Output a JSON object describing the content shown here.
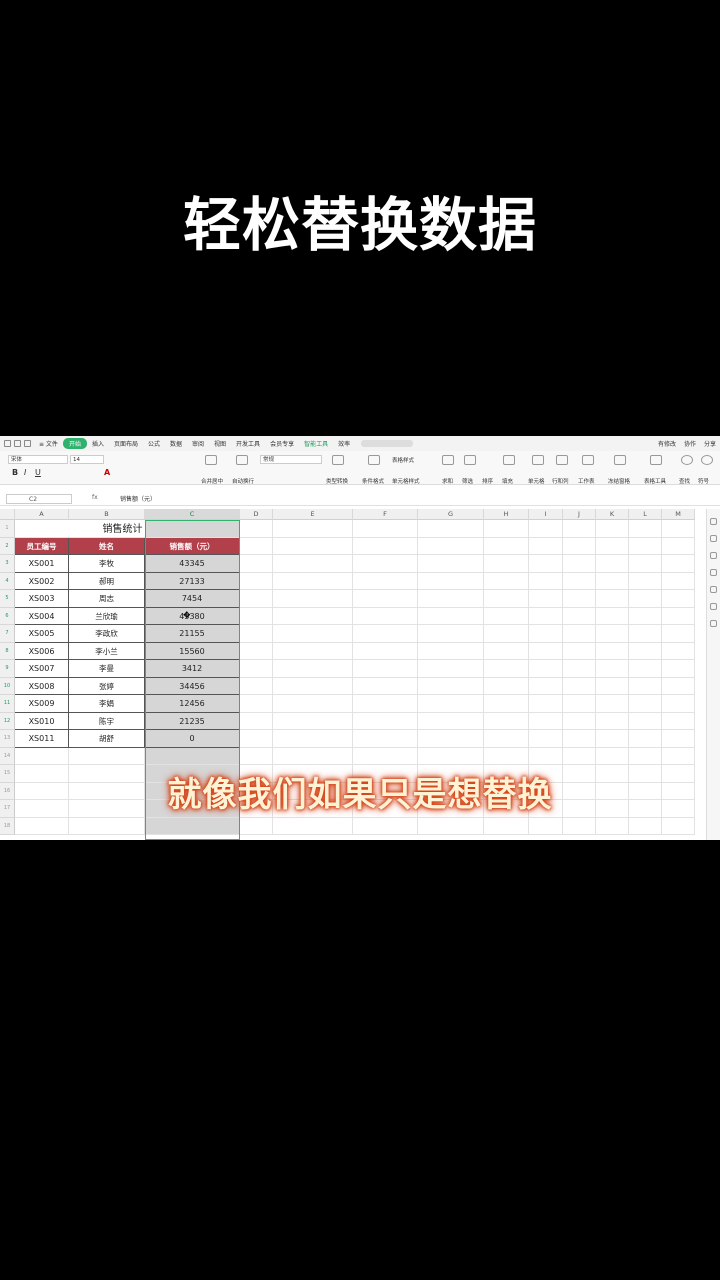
{
  "video": {
    "title": "轻松替换数据",
    "subtitle": "就像我们如果只是想替换"
  },
  "colors": {
    "accent": "#2fb26e",
    "header_fill": "#b2404b",
    "selection_fill": "#d6d6d6",
    "subtitle_glow": "#d2421a"
  },
  "menubar": {
    "items": [
      {
        "label": "≡ 文件"
      },
      {
        "label": "开始",
        "active": true
      },
      {
        "label": "插入"
      },
      {
        "label": "页面布局"
      },
      {
        "label": "公式"
      },
      {
        "label": "数据"
      },
      {
        "label": "审阅"
      },
      {
        "label": "视图"
      },
      {
        "label": "开发工具"
      },
      {
        "label": "会员专享"
      },
      {
        "label": "智能工具",
        "green": true
      },
      {
        "label": "效率"
      }
    ],
    "right": [
      "有修改",
      "协作",
      "分享"
    ]
  },
  "ribbon": {
    "font_name": "宋体",
    "font_size": "14",
    "number_format": "常规",
    "labels": [
      "合并居中",
      "自动换行",
      "类型转换",
      "条件格式",
      "表格样式",
      "单元格样式",
      "求和",
      "筛选",
      "排序",
      "填充",
      "单元格",
      "行和列",
      "工作表",
      "冻结窗格",
      "表格工具",
      "查找",
      "符号"
    ]
  },
  "formula_bar": {
    "name_box": "C2",
    "fx": "fx",
    "content": "销售额（元）"
  },
  "sheet": {
    "columns": [
      "A",
      "B",
      "C",
      "D",
      "E",
      "F",
      "G",
      "H",
      "I",
      "J",
      "K",
      "L",
      "M"
    ],
    "selected_column": "C",
    "rows": [
      "1",
      "2",
      "3",
      "4",
      "5",
      "6",
      "7",
      "8",
      "9",
      "10",
      "11",
      "12",
      "13",
      "14",
      "15",
      "16",
      "17",
      "18"
    ],
    "table_title": "销售统计",
    "headers": [
      "员工编号",
      "姓名",
      "销售额（元）"
    ],
    "data": [
      [
        "XS001",
        "李牧",
        "43345"
      ],
      [
        "XS002",
        "郝明",
        "27133"
      ],
      [
        "XS003",
        "周志",
        "7454"
      ],
      [
        "XS004",
        "兰欣瑜",
        "45380"
      ],
      [
        "XS005",
        "李政欣",
        "21155"
      ],
      [
        "XS006",
        "李小兰",
        "15560"
      ],
      [
        "XS007",
        "李曼",
        "3412"
      ],
      [
        "XS008",
        "张婷",
        "34456"
      ],
      [
        "XS009",
        "李娟",
        "12456"
      ],
      [
        "XS010",
        "陈宇",
        "21235"
      ],
      [
        "XS011",
        "胡舒",
        "0"
      ]
    ]
  }
}
